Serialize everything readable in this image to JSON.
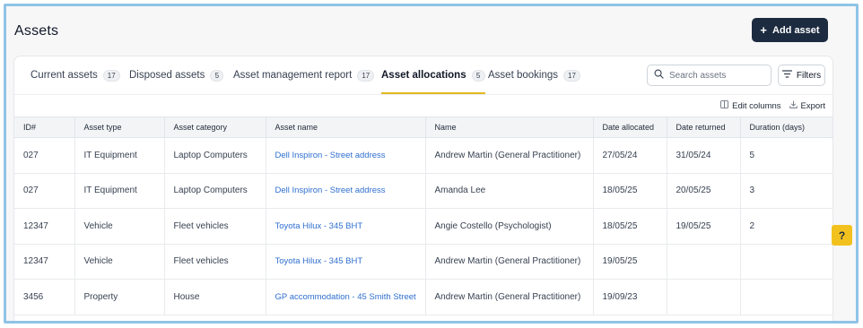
{
  "header": {
    "title": "Assets",
    "add_button_label": "Add asset"
  },
  "tabs": [
    {
      "label": "Current assets",
      "count": "17",
      "active": false
    },
    {
      "label": "Disposed assets",
      "count": "5",
      "active": false
    },
    {
      "label": "Asset management report",
      "count": "17",
      "active": false
    },
    {
      "label": "Asset allocations",
      "count": "5",
      "active": true
    },
    {
      "label": "Asset bookings",
      "count": "17",
      "active": false
    }
  ],
  "search": {
    "placeholder": "Search assets",
    "value": ""
  },
  "filters_label": "Filters",
  "toolbar": {
    "edit_columns_label": "Edit columns",
    "export_label": "Export"
  },
  "table": {
    "columns": [
      "ID#",
      "Asset type",
      "Asset category",
      "Asset name",
      "Name",
      "Date allocated",
      "Date returned",
      "Duration (days)"
    ],
    "rows": [
      [
        "027",
        "IT Equipment",
        "Laptop Computers",
        "Dell Inspiron - Street address",
        "Andrew Martin (General Practitioner)",
        "27/05/24",
        "31/05/24",
        "5"
      ],
      [
        "027",
        "IT Equipment",
        "Laptop Computers",
        "Dell Inspiron - Street address",
        "Amanda Lee",
        "18/05/25",
        "20/05/25",
        "3"
      ],
      [
        "12347",
        "Vehicle",
        "Fleet vehicles",
        "Toyota Hilux - 345 BHT",
        "Angie Costello (Psychologist)",
        "18/05/25",
        "19/05/25",
        "2"
      ],
      [
        "12347",
        "Vehicle",
        "Fleet vehicles",
        "Toyota Hilux - 345 BHT",
        "Andrew Martin (General Practitioner)",
        "19/05/25",
        "",
        ""
      ],
      [
        "3456",
        "Property",
        "House",
        "GP accommodation - 45 Smith Street",
        "Andrew Martin (General Practitioner)",
        "19/09/23",
        "",
        ""
      ]
    ]
  },
  "help_label": "?",
  "colors": {
    "brand_dark": "#1d2b40",
    "accent_yellow": "#e5b821",
    "link_blue": "#2f6fcf"
  }
}
